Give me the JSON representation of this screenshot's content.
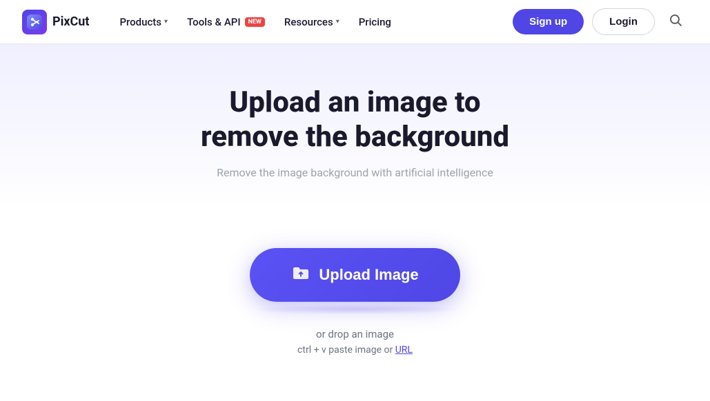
{
  "brand": {
    "logo_text": "PixCut",
    "logo_icon": "✂"
  },
  "nav": {
    "items": [
      {
        "label": "Products",
        "has_dropdown": true,
        "has_badge": false
      },
      {
        "label": "Tools & API",
        "has_dropdown": false,
        "has_badge": true,
        "badge_text": "NEW"
      },
      {
        "label": "Resources",
        "has_dropdown": true,
        "has_badge": false
      },
      {
        "label": "Pricing",
        "has_dropdown": false,
        "has_badge": false
      }
    ],
    "signup_label": "Sign up",
    "login_label": "Login"
  },
  "hero": {
    "title_line1": "Upload an image to",
    "title_line2": "remove the background",
    "subtitle": "Remove the image background with artificial intelligence"
  },
  "upload": {
    "button_label": "Upload Image",
    "drop_text": "or drop an image",
    "paste_text": "ctrl + v paste image or",
    "url_link_text": "URL"
  }
}
